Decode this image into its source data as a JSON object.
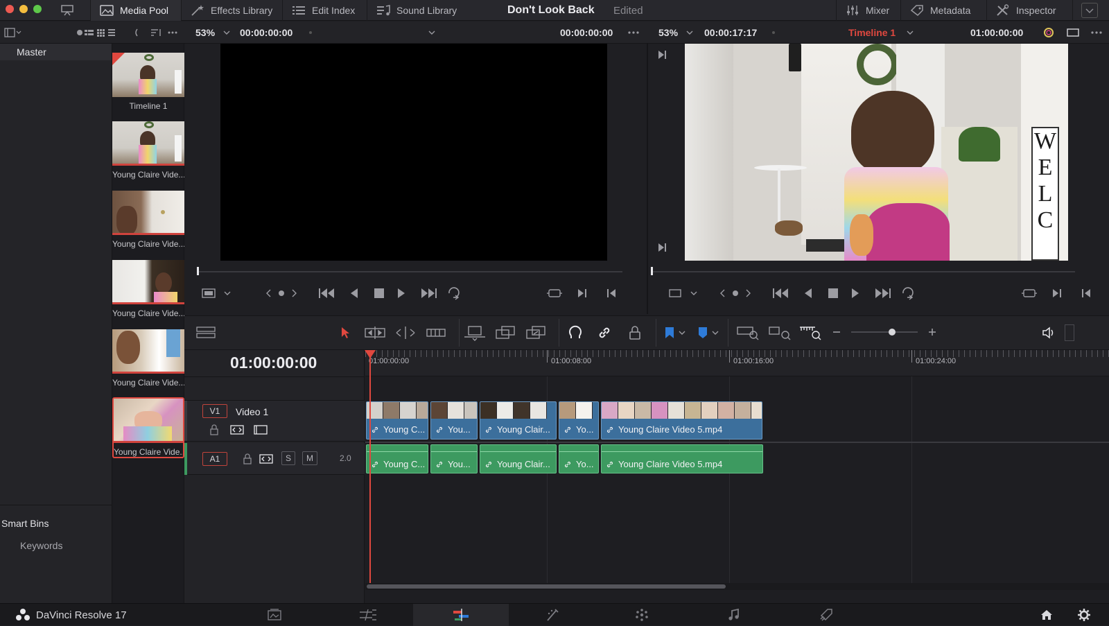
{
  "window": {
    "project_title": "Don't Look Back",
    "project_status": "Edited"
  },
  "toolbar": {
    "media_pool": "Media Pool",
    "effects_library": "Effects Library",
    "edit_index": "Edit Index",
    "sound_library": "Sound Library",
    "mixer": "Mixer",
    "metadata": "Metadata",
    "inspector": "Inspector"
  },
  "source_viewer": {
    "zoom": "53%",
    "timecode_left": "00:00:00:00",
    "timecode_right": "00:00:00:00"
  },
  "timeline_viewer": {
    "zoom": "53%",
    "duration": "00:00:17:17",
    "timeline_name": "Timeline 1",
    "timecode": "01:00:00:00"
  },
  "media_pool": {
    "master_label": "Master",
    "smart_bins_label": "Smart Bins",
    "keywords_label": "Keywords",
    "clips": [
      {
        "name": "Timeline 1"
      },
      {
        "name": "Young Claire Vide..."
      },
      {
        "name": "Young Claire Vide..."
      },
      {
        "name": "Young Claire Vide..."
      },
      {
        "name": "Young Claire Vide..."
      },
      {
        "name": "Young Claire Vide..."
      }
    ]
  },
  "timeline": {
    "current_timecode": "01:00:00:00",
    "ruler": [
      "01:00:00:00",
      "01:00:08:00",
      "01:00:16:00",
      "01:00:24:00"
    ],
    "video_track": {
      "id": "V1",
      "name": "Video 1"
    },
    "audio_track": {
      "id": "A1",
      "level": "2.0",
      "solo": "S",
      "mute": "M"
    },
    "video_clips": [
      "Young C...",
      "You...",
      "Young Clair...",
      "Yo...",
      "Young Claire Video 5.mp4"
    ],
    "audio_clips": [
      "Young C...",
      "You...",
      "Young Clair...",
      "Yo...",
      "Young Claire Video 5.mp4"
    ]
  },
  "app": {
    "name": "DaVinci Resolve 17"
  },
  "colors": {
    "accent_red": "#e0483f",
    "video_clip": "#3c6f9c",
    "audio_clip": "#3d9a60"
  }
}
